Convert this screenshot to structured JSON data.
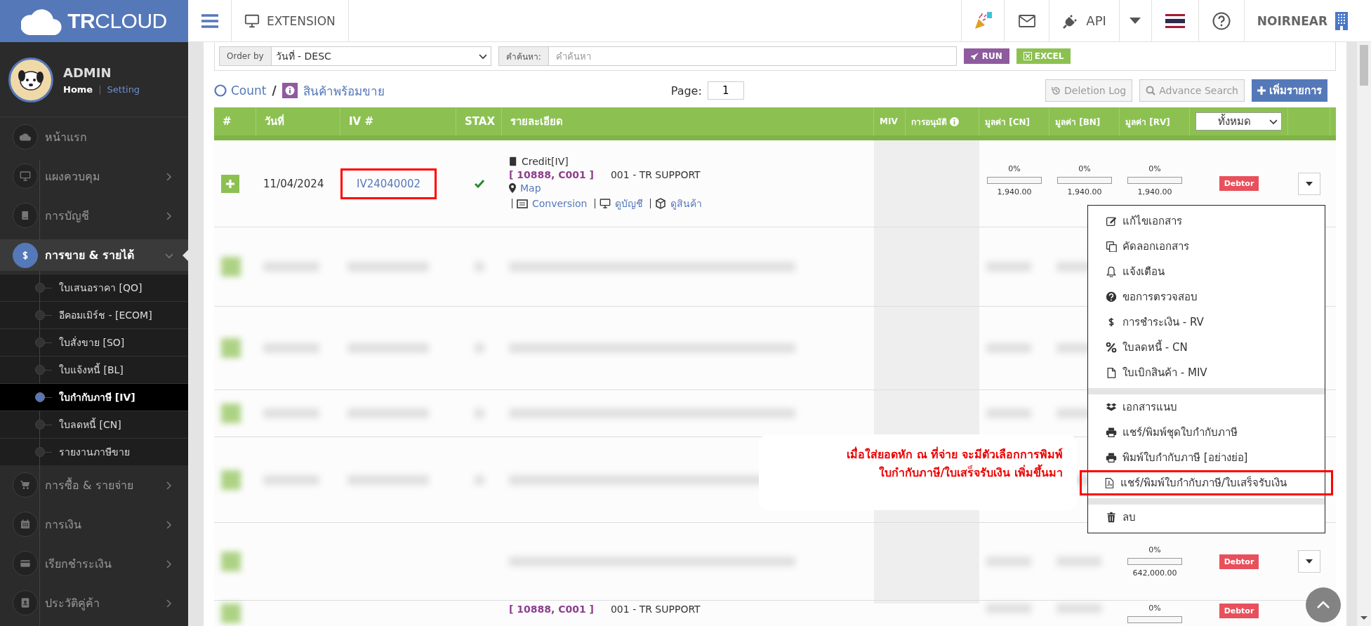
{
  "header": {
    "logo": "**TR**CLOUD",
    "extension": "EXTENSION",
    "api": "API",
    "company": "NOIRNEAR"
  },
  "sidebar": {
    "user": "ADMIN",
    "home": "Home",
    "separator": "|",
    "setting": "Setting",
    "items": [
      {
        "label": "หน้าแรก",
        "selected": false
      },
      {
        "label": "แผงควบคุม",
        "selected": false,
        "expanded": false
      },
      {
        "label": "การบัญชี",
        "selected": false,
        "expanded": false
      },
      {
        "label": "การขาย & รายได้",
        "selected": true,
        "expanded": true,
        "children": [
          {
            "label": "ใบเสนอราคา [QO]",
            "selected": false
          },
          {
            "label": "อีคอมเมิร์ช - [ECOM]",
            "selected": false
          },
          {
            "label": "ใบสั่งขาย [SO]",
            "selected": false
          },
          {
            "label": "ใบแจ้งหนี้ [BL]",
            "selected": false
          },
          {
            "label": "ใบกำกับภาษี [IV]",
            "selected": true
          },
          {
            "label": "ใบลดหนี้ [CN]",
            "selected": false
          },
          {
            "label": "รายงานภาษีขาย",
            "selected": false
          }
        ]
      },
      {
        "label": "การซื้อ & รายจ่าย",
        "selected": false,
        "expanded": false
      },
      {
        "label": "การเงิน",
        "selected": false,
        "expanded": false
      },
      {
        "label": "เรียกชำระเงิน",
        "selected": false,
        "expanded": false
      },
      {
        "label": "ประวัติคู่ค้า",
        "selected": false,
        "expanded": false
      }
    ]
  },
  "filters": {
    "order_label": "Order by",
    "order_value": "วันที่ - DESC",
    "search_label": "คำค้นหา:",
    "search_placeholder": "คำค้นหา",
    "run": "RUN",
    "excel": "EXCEL"
  },
  "toolbar": {
    "count": "Count",
    "slash": "/",
    "category": "สินค้าพร้อมขาย",
    "page_label": "Page:",
    "page": "1",
    "deletion_log": "Deletion Log",
    "advance_search": "Advance Search",
    "add": "เพิ่มรายการ"
  },
  "table": {
    "columns": [
      "#",
      "วันที่",
      "IV #",
      "STAX",
      "รายละเอียด",
      "MIV",
      "การอนุมัติ",
      "มูลค่า [CN]",
      "มูลค่า [BN]",
      "มูลค่า [RV]"
    ],
    "filter": "ทั้งหมด",
    "rows": [
      {
        "kind": "full",
        "date": "11/04/2024",
        "number": "IV24040002",
        "highlighted": true,
        "stax": true,
        "doc_type": "Credit[IV]",
        "codes": "[ 10888, C001 ]",
        "customer": "001 - TR SUPPORT",
        "map": "Map",
        "links": [
          "Conversion",
          "ดูบัญชี",
          "ดูสินค้า"
        ],
        "values": [
          {
            "percent": "0%",
            "level": 0,
            "amount": "1,940.00"
          },
          {
            "percent": "0%",
            "level": 0,
            "amount": "1,940.00"
          },
          {
            "percent": "0%",
            "level": 0,
            "amount": "1,940.00"
          }
        ],
        "status": "Debtor"
      },
      {
        "kind": "blurred"
      },
      {
        "kind": "blurred"
      },
      {
        "kind": "blurred"
      },
      {
        "kind": "blurred"
      },
      {
        "kind": "partial",
        "values": [
          {
            "percent": "0%",
            "level": 0,
            "amount": "642,000.00"
          }
        ],
        "status": "Debtor"
      },
      {
        "kind": "partial",
        "codes": "[ 10888, C001 ]",
        "customer": "001 - TR SUPPORT",
        "values": [
          {
            "percent": "0%",
            "level": 0
          }
        ],
        "status": "Debtor"
      }
    ]
  },
  "menu": {
    "groups": [
      [
        {
          "label": "แก้ไขเอกสาร",
          "highlighted": false
        },
        {
          "label": "คัดลอกเอกสาร",
          "highlighted": false
        },
        {
          "label": "แจ้งเตือน",
          "highlighted": false
        },
        {
          "label": "ขอการตรวจสอบ",
          "highlighted": false
        },
        {
          "label": "การชำระเงิน - RV",
          "highlighted": false
        },
        {
          "label": "ใบลดหนี้ - CN",
          "highlighted": false
        },
        {
          "label": "ใบเบิกสินค้า - MIV",
          "highlighted": false
        }
      ],
      [
        {
          "label": "เอกสารแนบ",
          "highlighted": false
        },
        {
          "label": "แชร์/พิมพ์ชุดใบกำกับภาษี",
          "highlighted": false
        },
        {
          "label": "พิมพ์ใบกำกับภาษี [อย่างย่อ]",
          "highlighted": false
        },
        {
          "label": "แชร์/พิมพ์ใบกำกับภาษี/ใบเสร็จรับเงิน",
          "highlighted": true
        }
      ],
      [
        {
          "label": "ลบ",
          "highlighted": false
        }
      ]
    ]
  },
  "callout": {
    "lines": [
      "เมื่อใส่ยอดหัก ณ ที่จ่าย จะมีตัวเลือกการพิมพ์",
      "ใบกำกับภาษี/ใบเสร็จรับเงิน เพิ่มขึ้นมา"
    ]
  }
}
